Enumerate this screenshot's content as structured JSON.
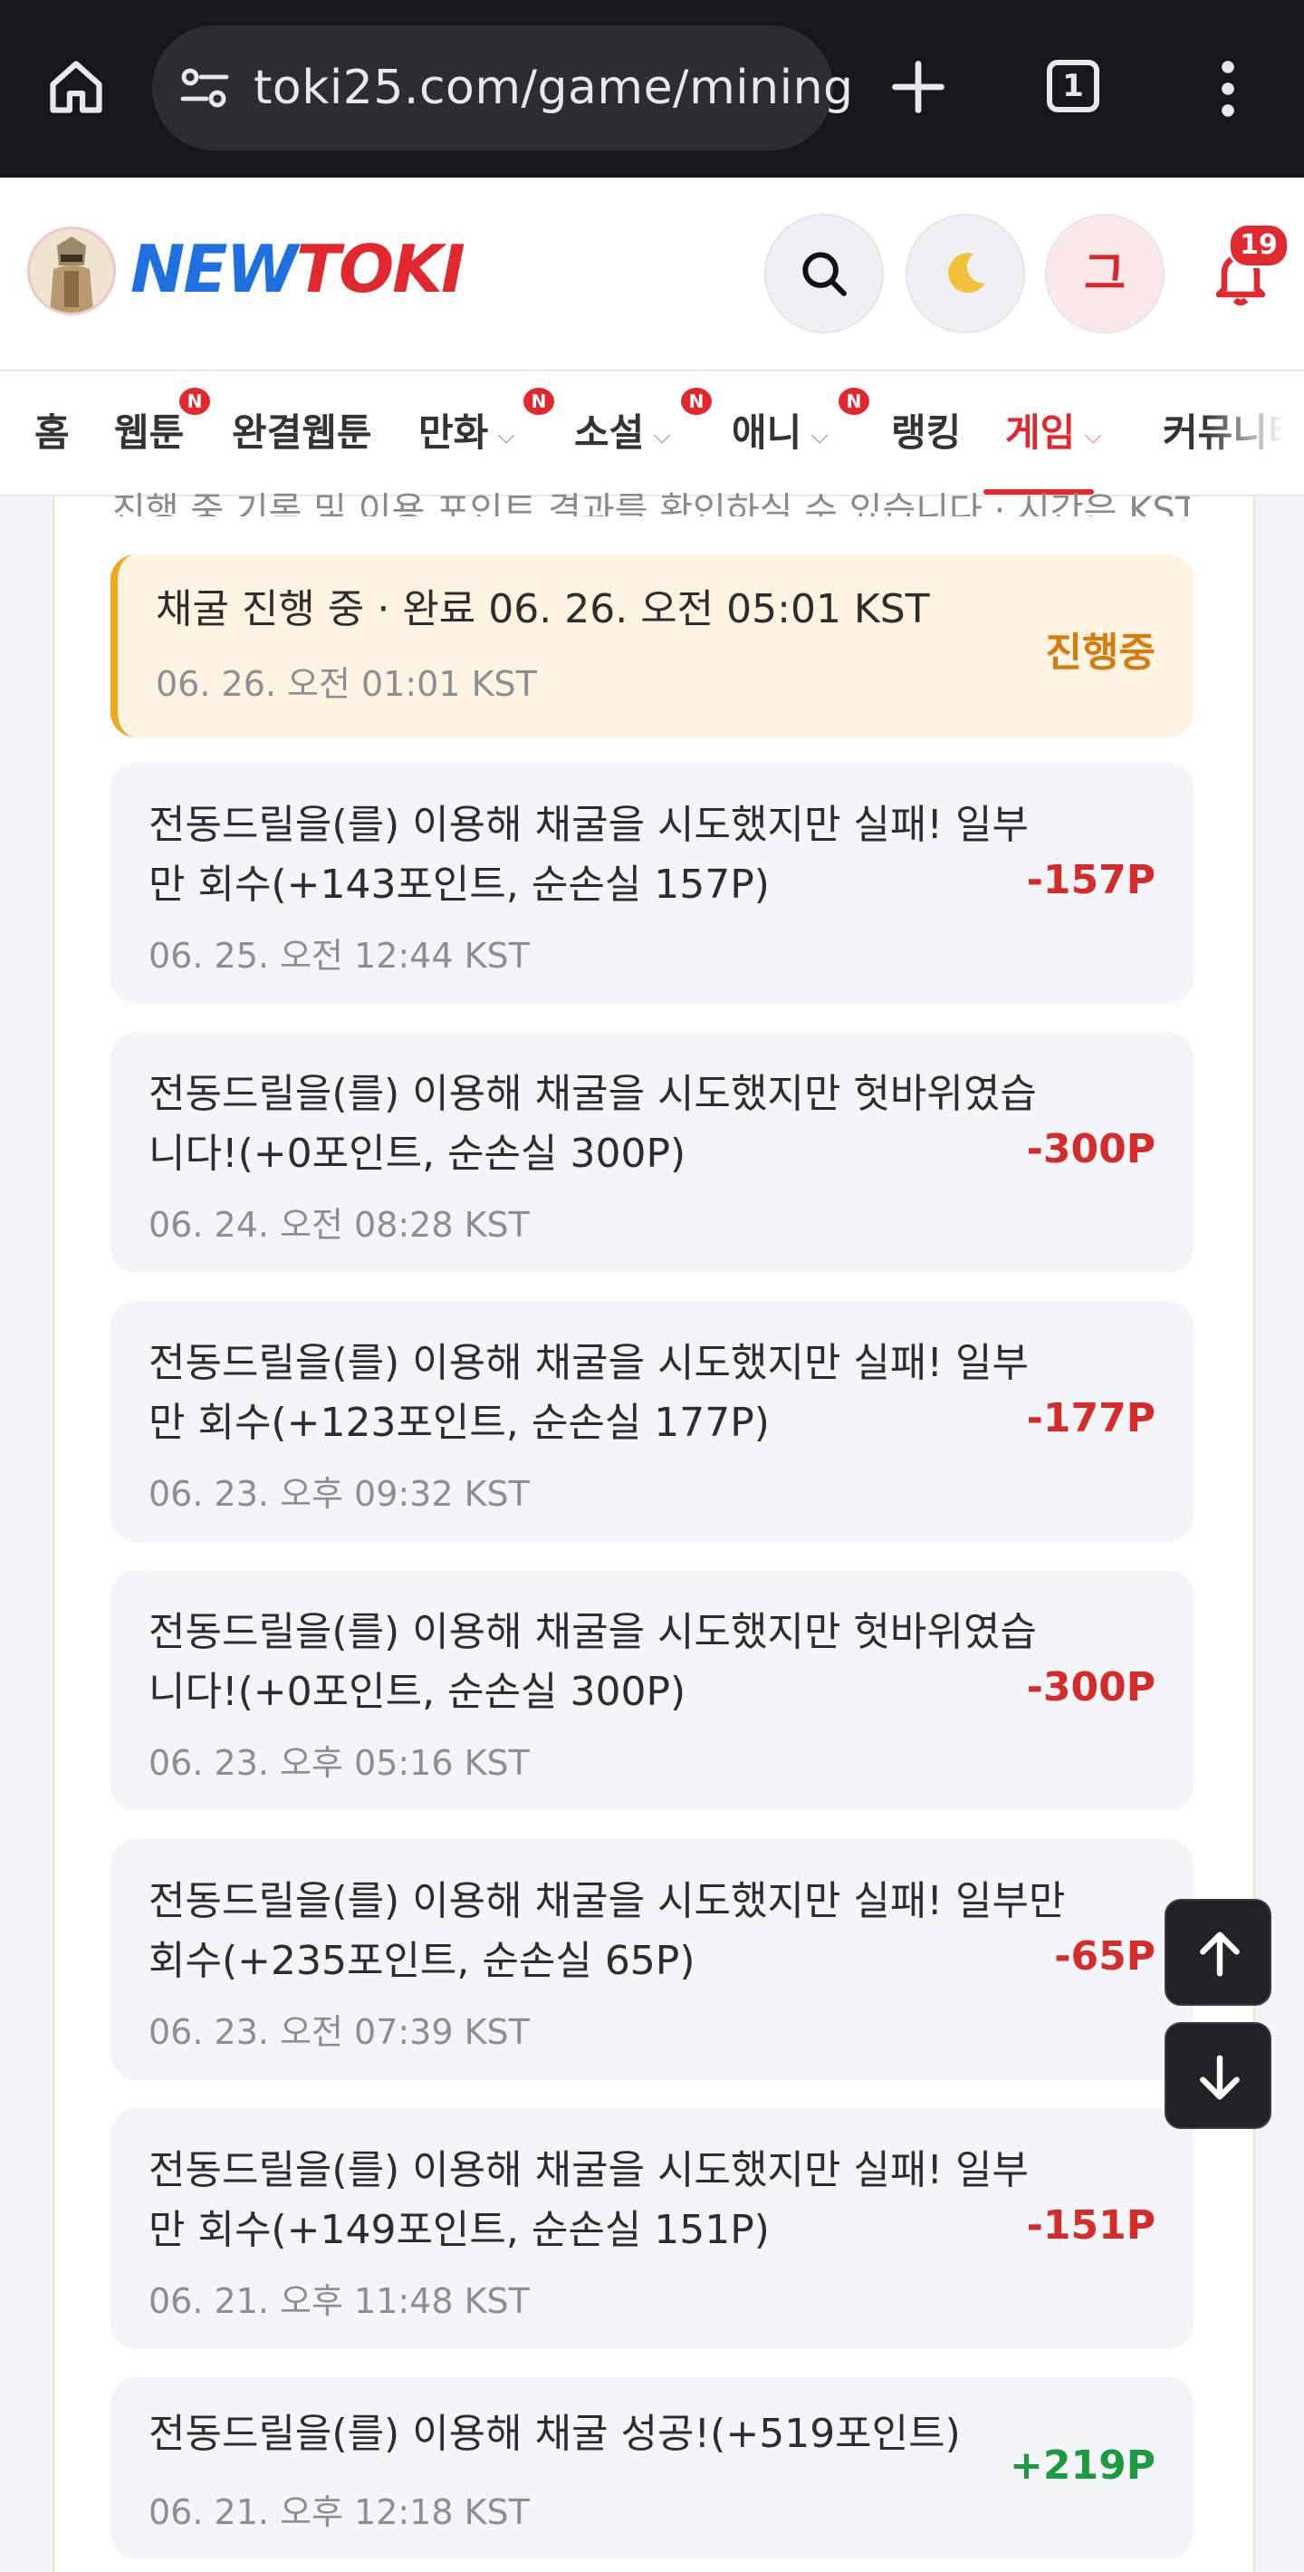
{
  "browser": {
    "url": "toki25.com/game/mining",
    "tab_count": "1"
  },
  "header": {
    "logo_new": "NEW",
    "logo_toki": "TOKI",
    "profile_initial": "그",
    "notification_count": "19"
  },
  "nav": {
    "items": [
      {
        "label": "홈",
        "badge": ""
      },
      {
        "label": "웹툰",
        "badge": "N"
      },
      {
        "label": "완결웹툰",
        "badge": ""
      },
      {
        "label": "만화",
        "badge": "N"
      },
      {
        "label": "소설",
        "badge": "N"
      },
      {
        "label": "애니",
        "badge": "N"
      },
      {
        "label": "랭킹",
        "badge": ""
      },
      {
        "label": "게임",
        "badge": ""
      },
      {
        "label": "커뮤니티",
        "badge": ""
      }
    ],
    "active": "게임"
  },
  "panel": {
    "cut_text": "진행 중 기록 및 이용 포인트 결과를 확인하실 수 있습니다 · 시간은 KST 기준"
  },
  "log": [
    {
      "message": "채굴 진행 중 · 완료 06. 26. 오전 05:01 KST",
      "time": "06. 26. 오전 01:01 KST",
      "amount": "진행중",
      "status": "active"
    },
    {
      "message": "전동드릴을(를) 이용해 채굴을 시도했지만 실패! 일부만 회수(+143포인트, 순손실 157P)",
      "time": "06. 25. 오전 12:44 KST",
      "amount": "-157P",
      "status": "loss"
    },
    {
      "message": "전동드릴을(를) 이용해 채굴을 시도했지만 헛바위였습니다!(+0포인트, 순손실 300P)",
      "time": "06. 24. 오전 08:28 KST",
      "amount": "-300P",
      "status": "loss"
    },
    {
      "message": "전동드릴을(를) 이용해 채굴을 시도했지만 실패! 일부만 회수(+123포인트, 순손실 177P)",
      "time": "06. 23. 오후 09:32 KST",
      "amount": "-177P",
      "status": "loss"
    },
    {
      "message": "전동드릴을(를) 이용해 채굴을 시도했지만 헛바위였습니다!(+0포인트, 순손실 300P)",
      "time": "06. 23. 오후 05:16 KST",
      "amount": "-300P",
      "status": "loss"
    },
    {
      "message": "전동드릴을(를) 이용해 채굴을 시도했지만 실패! 일부만 회수(+235포인트, 순손실 65P)",
      "time": "06. 23. 오전 07:39 KST",
      "amount": "-65P",
      "status": "loss"
    },
    {
      "message": "전동드릴을(를) 이용해 채굴을 시도했지만 실패! 일부만 회수(+149포인트, 순손실 151P)",
      "time": "06. 21. 오후 11:48 KST",
      "amount": "-151P",
      "status": "loss"
    },
    {
      "message": "전동드릴을(를) 이용해 채굴 성공!(+519포인트)",
      "time": "06. 21. 오후 12:18 KST",
      "amount": "+219P",
      "status": "gain"
    }
  ],
  "colors": {
    "accent_red": "#e0282e",
    "loss": "#d42b2b",
    "gain": "#1c9a3f",
    "active": "#d77a10",
    "logo_blue": "#1e6fe0"
  },
  "icons": [
    "home-icon",
    "site-info-icon",
    "new-tab-icon",
    "tab-switcher-icon",
    "menu-icon",
    "search-icon",
    "moon-icon",
    "bell-icon",
    "arrow-up-icon",
    "arrow-down-icon"
  ]
}
